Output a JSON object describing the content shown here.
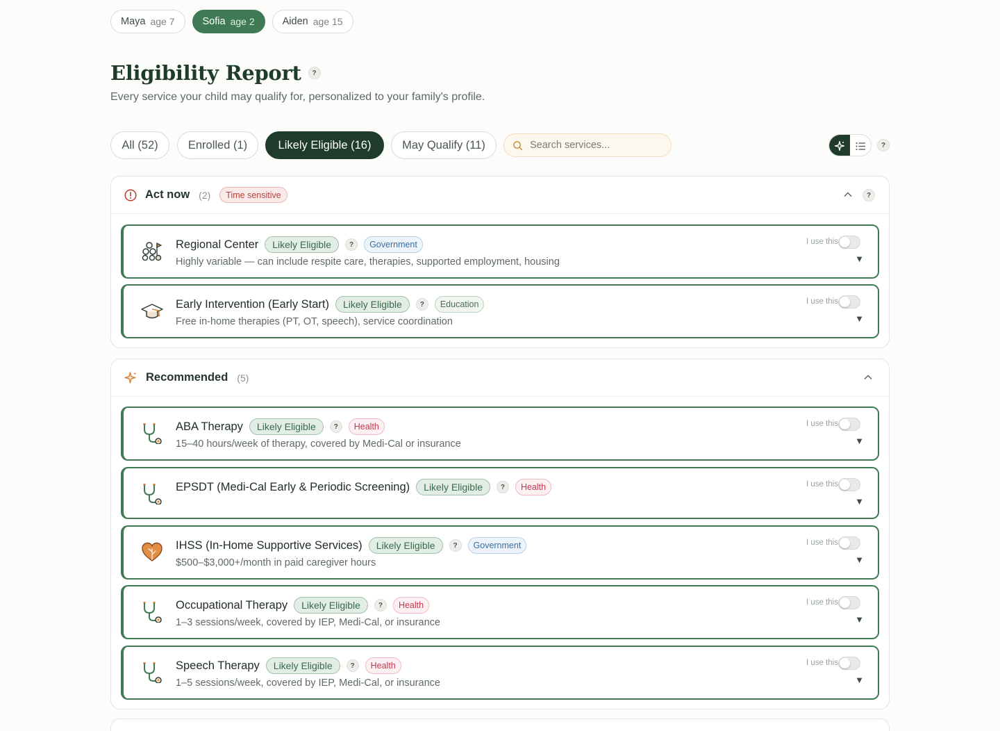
{
  "children": [
    {
      "name": "Maya",
      "age": "age 7",
      "active": false
    },
    {
      "name": "Sofia",
      "age": "age 2",
      "active": true
    },
    {
      "name": "Aiden",
      "age": "age 15",
      "active": false
    }
  ],
  "header": {
    "title": "Eligibility Report",
    "help": "?",
    "subtitle": "Every service your child may qualify for, personalized to your family's profile."
  },
  "filters": [
    {
      "label": "All (52)",
      "active": false
    },
    {
      "label": "Enrolled (1)",
      "active": false
    },
    {
      "label": "Likely Eligible (16)",
      "active": true
    },
    {
      "label": "May Qualify (11)",
      "active": false
    }
  ],
  "search": {
    "placeholder": "Search services..."
  },
  "toolbar": {
    "help": "?",
    "view_mode": "recommended"
  },
  "sections": [
    {
      "title": "Act now",
      "count": "(2)",
      "badge": "Time sensitive",
      "help": "?",
      "icon": "alert-circle-icon",
      "cards": [
        {
          "name": "Regional Center",
          "eligibility": "Likely Eligible",
          "help": "?",
          "category": "Government",
          "category_type": "gov",
          "description": "Highly variable — can include respite care, therapies, supported employment, housing",
          "icon": "community-icon",
          "use_label": "I use this",
          "use": false,
          "caret": "▼"
        },
        {
          "name": "Early Intervention (Early Start)",
          "eligibility": "Likely Eligible",
          "help": "?",
          "category": "Education",
          "category_type": "edu",
          "description": "Free in-home therapies (PT, OT, speech), service coordination",
          "icon": "graduation-cap-icon",
          "use_label": "I use this",
          "use": false,
          "caret": "▼"
        }
      ]
    },
    {
      "title": "Recommended",
      "count": "(5)",
      "icon": "sparkle-icon",
      "cards": [
        {
          "name": "ABA Therapy",
          "eligibility": "Likely Eligible",
          "help": "?",
          "category": "Health",
          "category_type": "health",
          "description": "15–40 hours/week of therapy, covered by Medi-Cal or insurance",
          "icon": "stethoscope-icon",
          "use_label": "I use this",
          "use": false,
          "caret": "▼"
        },
        {
          "name": "EPSDT (Medi-Cal Early & Periodic Screening)",
          "eligibility": "Likely Eligible",
          "help": "?",
          "category": "Health",
          "category_type": "health",
          "description": "",
          "icon": "stethoscope-icon",
          "use_label": "I use this",
          "use": false,
          "caret": "▼"
        },
        {
          "name": "IHSS (In-Home Supportive Services)",
          "eligibility": "Likely Eligible",
          "help": "?",
          "category": "Government",
          "category_type": "gov",
          "description": "$500–$3,000+/month in paid caregiver hours",
          "icon": "heart-hands-icon",
          "use_label": "I use this",
          "use": false,
          "caret": "▼"
        },
        {
          "name": "Occupational Therapy",
          "eligibility": "Likely Eligible",
          "help": "?",
          "category": "Health",
          "category_type": "health",
          "description": "1–3 sessions/week, covered by IEP, Medi-Cal, or insurance",
          "icon": "stethoscope-icon",
          "use_label": "I use this",
          "use": false,
          "caret": "▼"
        },
        {
          "name": "Speech Therapy",
          "eligibility": "Likely Eligible",
          "help": "?",
          "category": "Health",
          "category_type": "health",
          "description": "1–5 sessions/week, covered by IEP, Medi-Cal, or insurance",
          "icon": "stethoscope-icon",
          "use_label": "I use this",
          "use": false,
          "caret": "▼"
        }
      ]
    }
  ],
  "colors": {
    "brand_dark": "#1f3b2c",
    "brand": "#3f7a55",
    "accent": "#d9843a",
    "alert": "#c0392b"
  }
}
